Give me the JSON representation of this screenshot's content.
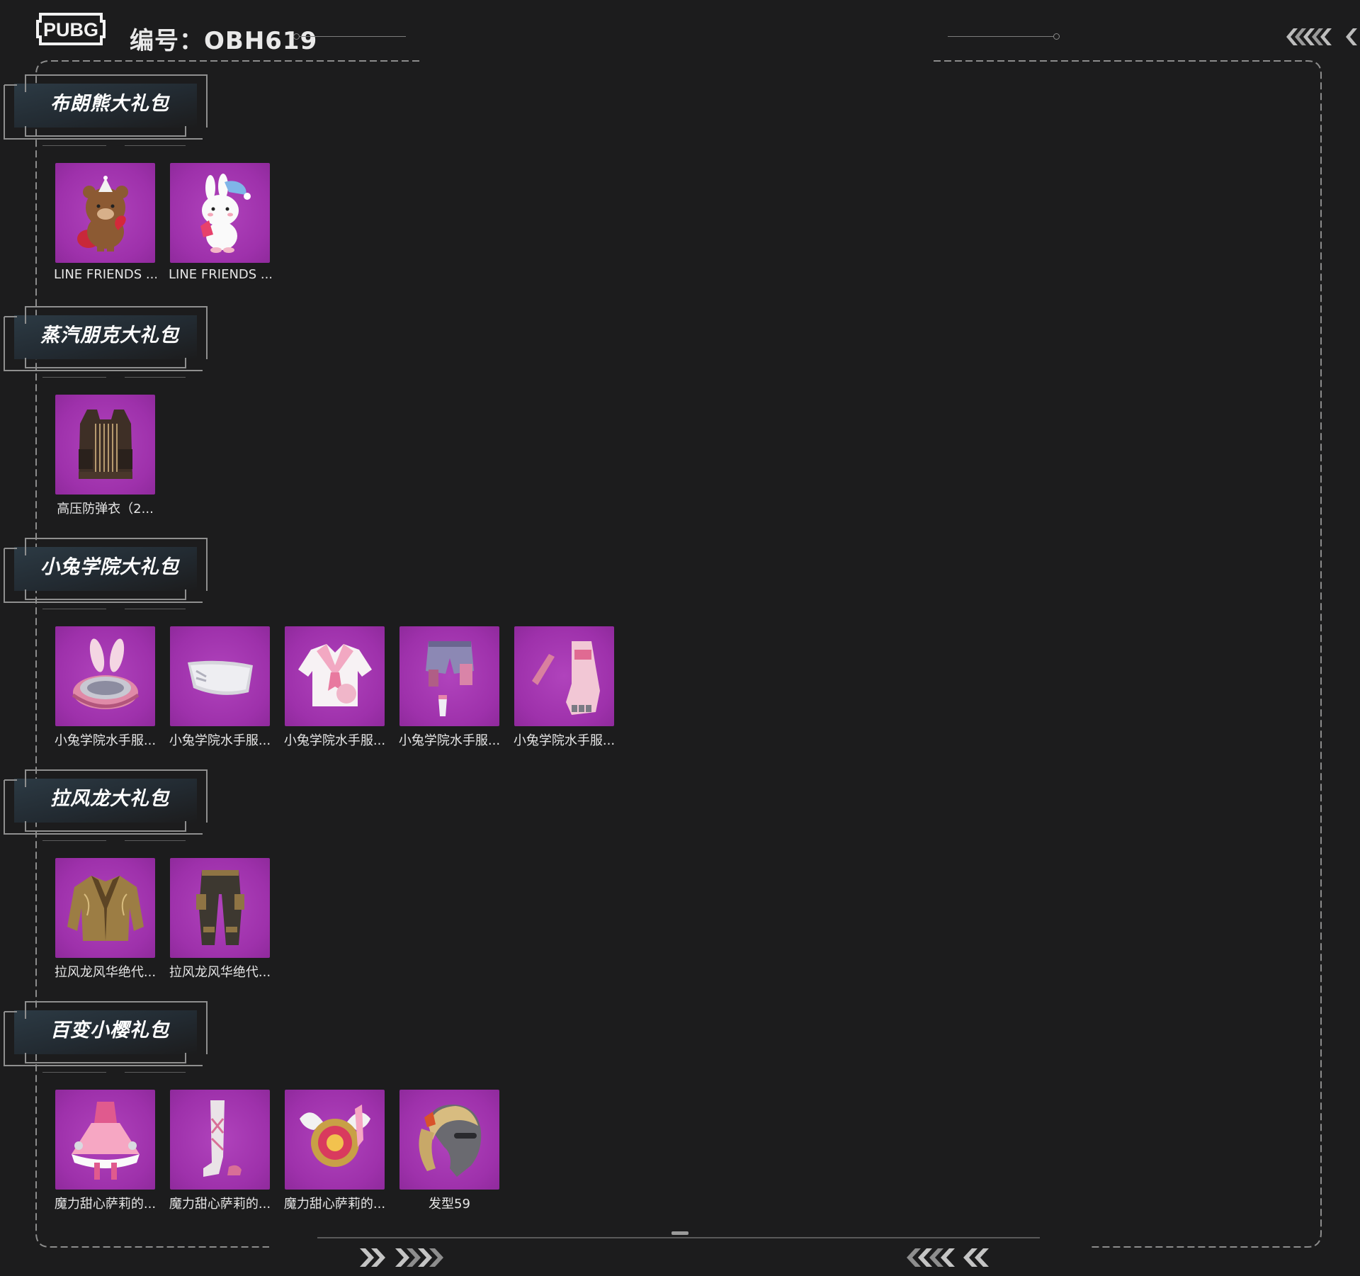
{
  "header": {
    "logo_text": "PUBG",
    "serial_label": "编号：",
    "serial_value": "OBH619"
  },
  "colors": {
    "background": "#1c1c1d",
    "item_tile": "#a336b0",
    "frame_line": "#8c8c8c"
  },
  "packs": [
    {
      "title": "布朗熊大礼包",
      "items": [
        {
          "name": "LINE FRIENDS ...",
          "icon": "brown-bear-icon"
        },
        {
          "name": "LINE FRIENDS ...",
          "icon": "white-bunny-icon"
        }
      ]
    },
    {
      "title": "蒸汽朋克大礼包",
      "items": [
        {
          "name": "高压防弹衣（2...",
          "icon": "armor-vest-icon"
        }
      ]
    },
    {
      "title": "小兔学院大礼包",
      "items": [
        {
          "name": "小兔学院水手服...",
          "icon": "bunny-helmet-icon"
        },
        {
          "name": "小兔学院水手服...",
          "icon": "face-mask-icon"
        },
        {
          "name": "小兔学院水手服...",
          "icon": "sailor-shirt-icon"
        },
        {
          "name": "小兔学院水手服...",
          "icon": "shorts-icon"
        },
        {
          "name": "小兔学院水手服...",
          "icon": "gloves-icon"
        }
      ]
    },
    {
      "title": "拉风龙大礼包",
      "items": [
        {
          "name": "拉风龙风华绝代...",
          "icon": "jacket-icon"
        },
        {
          "name": "拉风龙风华绝代...",
          "icon": "pants-icon"
        }
      ]
    },
    {
      "title": "百变小樱礼包",
      "items": [
        {
          "name": "魔力甜心萨莉的...",
          "icon": "dress-icon"
        },
        {
          "name": "魔力甜心萨莉的...",
          "icon": "boots-icon"
        },
        {
          "name": "魔力甜心萨莉的...",
          "icon": "winged-backpack-icon"
        },
        {
          "name": "发型59",
          "icon": "hairstyle-icon"
        }
      ]
    }
  ]
}
